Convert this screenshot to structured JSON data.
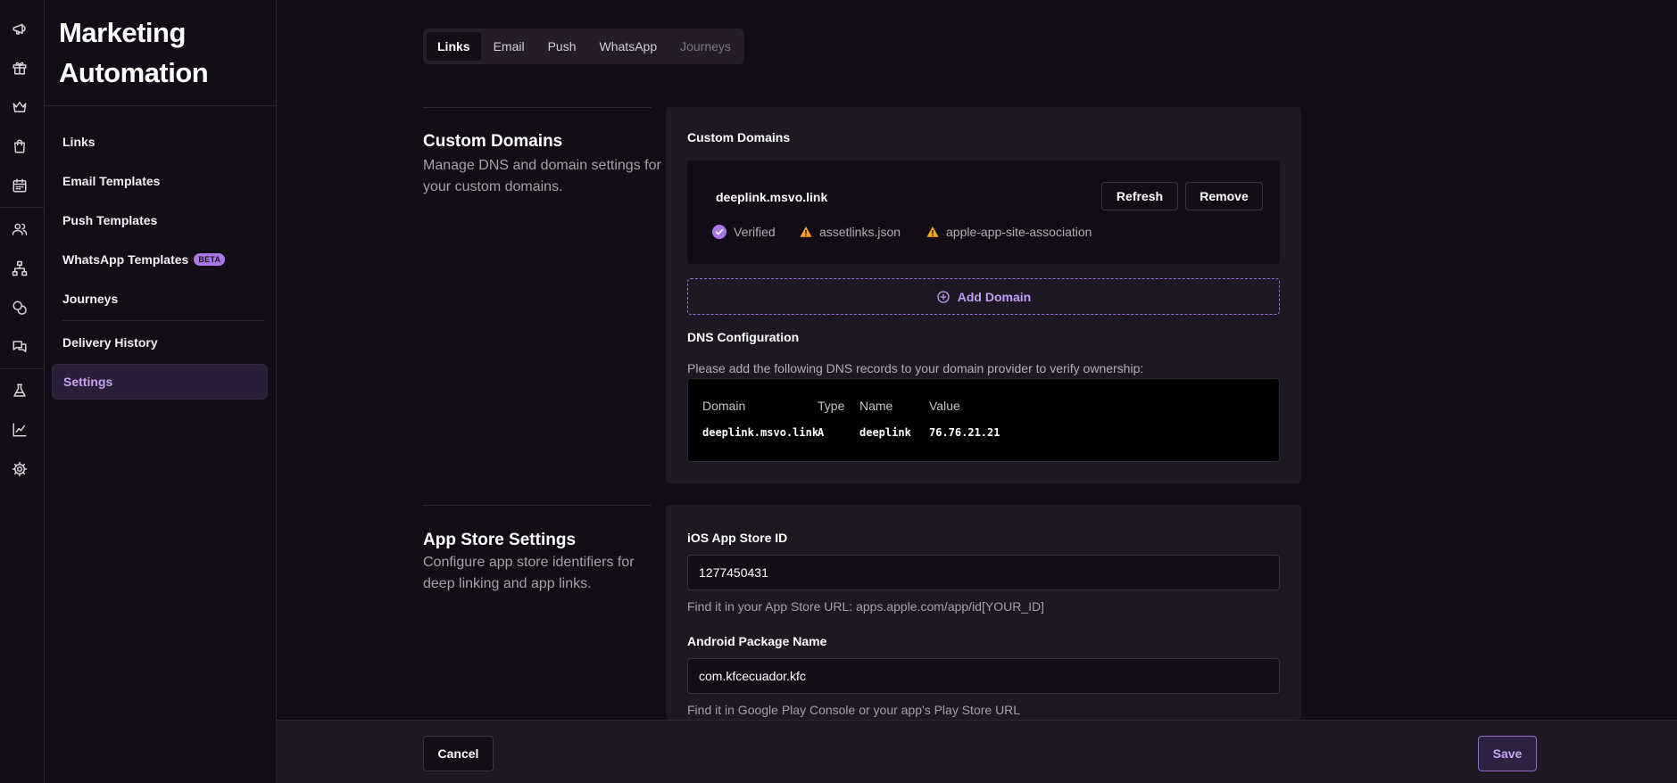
{
  "app": {
    "title": "Marketing Automation"
  },
  "rail": {
    "icons": [
      "megaphone-icon",
      "gift-icon",
      "crown-icon",
      "shopping-bag-icon",
      "calendar-icon",
      "users-icon",
      "hierarchy-icon",
      "coins-icon",
      "messages-icon",
      "flask-icon",
      "chart-line-icon",
      "gear-icon"
    ]
  },
  "sidebar": {
    "items": [
      {
        "label": "Links"
      },
      {
        "label": "Email Templates"
      },
      {
        "label": "Push Templates"
      },
      {
        "label": "WhatsApp Templates",
        "badge": "BETA"
      },
      {
        "label": "Journeys"
      },
      {
        "label": "Delivery History"
      },
      {
        "label": "Settings",
        "active": true
      }
    ]
  },
  "tabs": [
    {
      "label": "Links",
      "active": true
    },
    {
      "label": "Email"
    },
    {
      "label": "Push"
    },
    {
      "label": "WhatsApp"
    },
    {
      "label": "Journeys",
      "disabled": true
    }
  ],
  "custom_domains": {
    "title": "Custom Domains",
    "description": "Manage DNS and domain settings for your custom domains.",
    "card_label": "Custom Domains",
    "domain": {
      "name": "deeplink.msvo.link",
      "refresh_label": "Refresh",
      "remove_label": "Remove",
      "statuses": [
        {
          "label": "Verified",
          "state": "ok"
        },
        {
          "label": "assetlinks.json",
          "state": "warning"
        },
        {
          "label": "apple-app-site-association",
          "state": "warning"
        }
      ]
    },
    "add_domain_label": "Add Domain",
    "dns": {
      "title": "DNS Configuration",
      "help": "Please add the following DNS records to your domain provider to verify ownership:",
      "columns": [
        "Domain",
        "Type",
        "Name",
        "Value"
      ],
      "rows": [
        [
          "deeplink.msvo.link",
          "A",
          "deeplink",
          "76.76.21.21"
        ]
      ]
    }
  },
  "app_store": {
    "title": "App Store Settings",
    "description": "Configure app store identifiers for deep linking and app links.",
    "ios_label": "iOS App Store ID",
    "ios_value": "1277450431",
    "ios_hint": "Find it in your App Store URL: apps.apple.com/app/id[YOUR_ID]",
    "android_label": "Android Package Name",
    "android_value": "com.kfcecuador.kfc",
    "android_hint": "Find it in Google Play Console or your app's Play Store URL"
  },
  "footer": {
    "cancel_label": "Cancel",
    "save_label": "Save"
  },
  "colors": {
    "accent": "#a878e8",
    "background": "#130d18",
    "card": "#1e1823",
    "warning": "#f5a623"
  }
}
